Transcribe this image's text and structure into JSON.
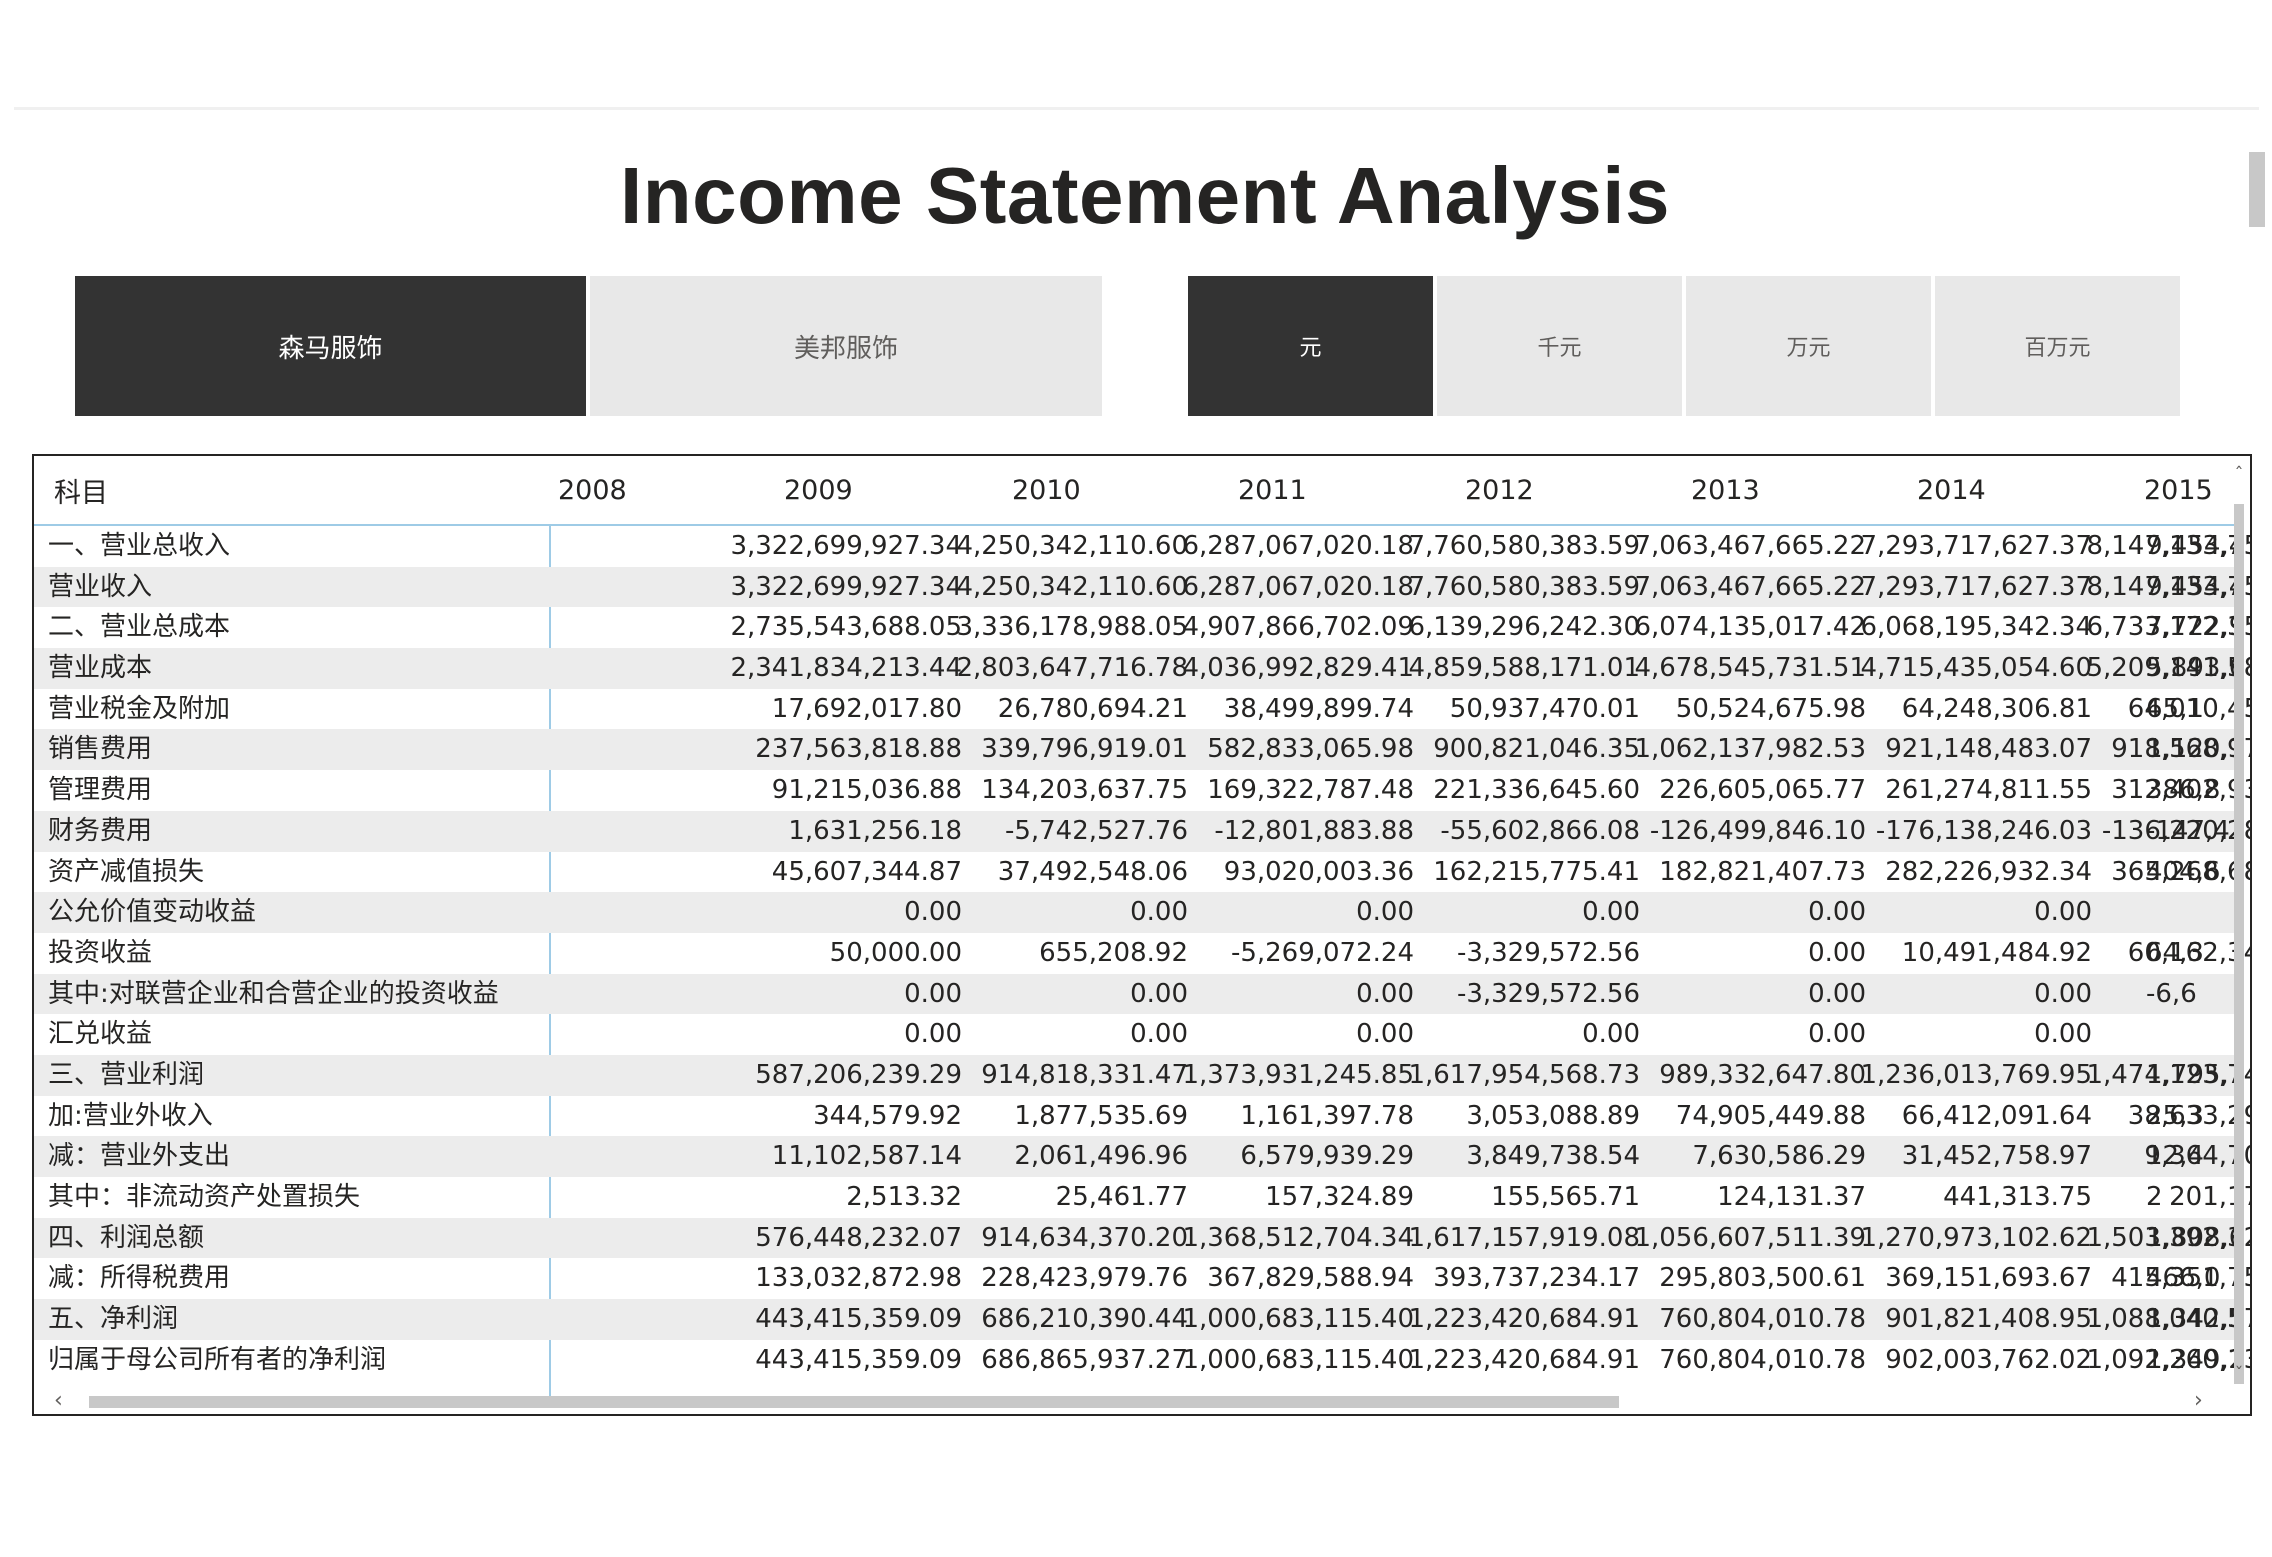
{
  "title": "Income Statement Analysis",
  "company_slicer": {
    "options": [
      "森马服饰",
      "美邦服饰"
    ],
    "selected": "森马服饰"
  },
  "unit_slicer": {
    "options": [
      "元",
      "千元",
      "万元",
      "百万元"
    ],
    "selected": "元"
  },
  "table": {
    "header_label": "科目",
    "years": [
      "2008",
      "2009",
      "2010",
      "2011",
      "2012",
      "2013",
      "2014",
      "2015"
    ],
    "rows": [
      {
        "label": "一、营业总收入",
        "values": [
          "3,322,699,927.34",
          "4,250,342,110.60",
          "6,287,067,020.18",
          "7,760,580,383.59",
          "7,063,467,665.22",
          "7,293,717,627.37",
          "8,147,133,752.42",
          "9,454,4"
        ]
      },
      {
        "label": "营业收入",
        "values": [
          "3,322,699,927.34",
          "4,250,342,110.60",
          "6,287,067,020.18",
          "7,760,580,383.59",
          "7,063,467,665.22",
          "7,293,717,627.37",
          "8,147,133,752.42",
          "9,454,4"
        ]
      },
      {
        "label": "二、营业总成本",
        "values": [
          "2,735,543,688.05",
          "3,336,178,988.05",
          "4,907,866,702.09",
          "6,139,296,242.30",
          "6,074,135,017.42",
          "6,068,195,342.34",
          "6,733,172,354.53",
          "7,722,9"
        ]
      },
      {
        "label": "营业成本",
        "values": [
          "2,341,834,213.44",
          "2,803,647,716.78",
          "4,036,992,829.41",
          "4,859,588,171.01",
          "4,678,545,731.51",
          "4,715,435,054.60",
          "5,209,141,583.64",
          "5,893,6"
        ]
      },
      {
        "label": "营业税金及附加",
        "values": [
          "17,692,017.80",
          "26,780,694.21",
          "38,499,899.74",
          "50,937,470.01",
          "50,524,675.98",
          "64,248,306.81",
          "64,010,454.30",
          "65,1"
        ]
      },
      {
        "label": "销售费用",
        "values": [
          "237,563,818.88",
          "339,796,919.01",
          "582,833,065.98",
          "900,821,046.35",
          "1,062,137,982.53",
          "921,148,483.07",
          "918,568,978.97",
          "1,120,1"
        ]
      },
      {
        "label": "管理费用",
        "values": [
          "91,215,036.88",
          "134,203,637.75",
          "169,322,787.48",
          "221,336,645.60",
          "226,605,065.77",
          "261,274,811.55",
          "312,402,935.88",
          "386,8"
        ]
      },
      {
        "label": "财务费用",
        "values": [
          "1,631,256.18",
          "-5,742,527.76",
          "-12,801,883.88",
          "-55,602,866.08",
          "-126,499,846.10",
          "-176,138,246.03",
          "-136,220,280.13",
          "-147,4"
        ]
      },
      {
        "label": "资产减值损失",
        "values": [
          "45,607,344.87",
          "37,492,548.06",
          "93,020,003.36",
          "162,215,775.41",
          "182,821,407.73",
          "282,226,932.34",
          "365,268,681.87",
          "404,6"
        ]
      },
      {
        "label": "公允价值变动收益",
        "values": [
          "0.00",
          "0.00",
          "0.00",
          "0.00",
          "0.00",
          "0.00",
          "0.00",
          ""
        ]
      },
      {
        "label": "投资收益",
        "values": [
          "50,000.00",
          "655,208.92",
          "-5,269,072.24",
          "-3,329,572.56",
          "0.00",
          "10,491,484.92",
          "60,162,343.12",
          "64,3"
        ]
      },
      {
        "label": "其中:对联营企业和合营企业的投资收益",
        "values": [
          "0.00",
          "0.00",
          "0.00",
          "-3,329,572.56",
          "0.00",
          "0.00",
          "0.00",
          "-6,6"
        ]
      },
      {
        "label": "汇兑收益",
        "values": [
          "0.00",
          "0.00",
          "0.00",
          "0.00",
          "0.00",
          "0.00",
          "0.00",
          ""
        ]
      },
      {
        "label": "三、营业利润",
        "values": [
          "587,206,239.29",
          "914,818,331.47",
          "1,373,931,245.85",
          "1,617,954,568.73",
          "989,332,647.80",
          "1,236,013,769.95",
          "1,474,123,741.01",
          "1,795,7"
        ]
      },
      {
        "label": "加:营业外收入",
        "values": [
          "344,579.92",
          "1,877,535.69",
          "1,161,397.78",
          "3,053,088.89",
          "74,905,449.88",
          "66,412,091.64",
          "38,633,290.61",
          "25,3"
        ]
      },
      {
        "label": "减：营业外支出",
        "values": [
          "11,102,587.14",
          "2,061,496.96",
          "6,579,939.29",
          "3,849,738.54",
          "7,630,586.29",
          "31,452,758.97",
          "9,364,705.21",
          "12,4"
        ]
      },
      {
        "label": "其中：非流动资产处置损失",
        "values": [
          "2,513.32",
          "25,461.77",
          "157,324.89",
          "155,565.71",
          "124,131.37",
          "441,313.75",
          "201,173.51",
          "2"
        ]
      },
      {
        "label": "四、利润总额",
        "values": [
          "576,448,232.07",
          "914,634,370.20",
          "1,368,512,704.34",
          "1,617,157,919.08",
          "1,056,607,511.39",
          "1,270,973,102.62",
          "1,503,392,326.41",
          "1,808,6"
        ]
      },
      {
        "label": "减：所得税费用",
        "values": [
          "133,032,872.98",
          "228,423,979.76",
          "367,829,588.94",
          "393,737,234.17",
          "295,803,500.61",
          "369,151,693.67",
          "415,351,755.51",
          "466,0"
        ]
      },
      {
        "label": "五、净利润",
        "values": [
          "443,415,359.09",
          "686,210,390.44",
          "1,000,683,115.40",
          "1,223,420,684.91",
          "760,804,010.78",
          "901,821,408.95",
          "1,088,040,570.90",
          "1,342,5"
        ]
      },
      {
        "label": "归属于母公司所有者的净利润",
        "values": [
          "443,415,359.09",
          "686,865,937.27",
          "1,000,683,115.40",
          "1,223,420,684.91",
          "760,804,010.78",
          "902,003,762.02",
          "1,092,260,134.05",
          "1,349,2"
        ]
      }
    ]
  }
}
